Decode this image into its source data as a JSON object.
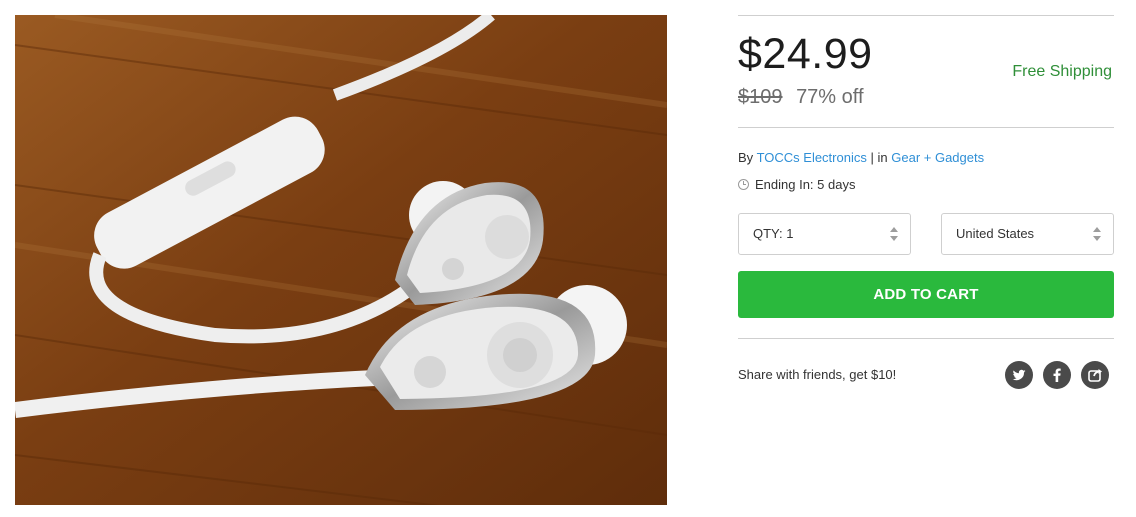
{
  "product": {
    "price": "$24.99",
    "original_price": "$109",
    "discount": "77% off",
    "shipping": "Free Shipping",
    "by_label": "By",
    "seller": "TOCCs Electronics",
    "separator": "|",
    "in_label": "in",
    "category": "Gear + Gadgets",
    "ending_label": "Ending In: 5 days"
  },
  "purchase": {
    "quantity_label": "QTY: 1",
    "country_label": "United States",
    "add_to_cart_label": "ADD TO CART"
  },
  "share": {
    "text": "Share with friends, get $10!",
    "icons": [
      "twitter-icon",
      "facebook-icon",
      "share-icon"
    ]
  },
  "colors": {
    "price_text": "#1d1d1d",
    "free_shipping": "#2f8f38",
    "link": "#2f8fd6",
    "cart_button": "#2ab93d",
    "social_circle": "#4a4a4a"
  }
}
